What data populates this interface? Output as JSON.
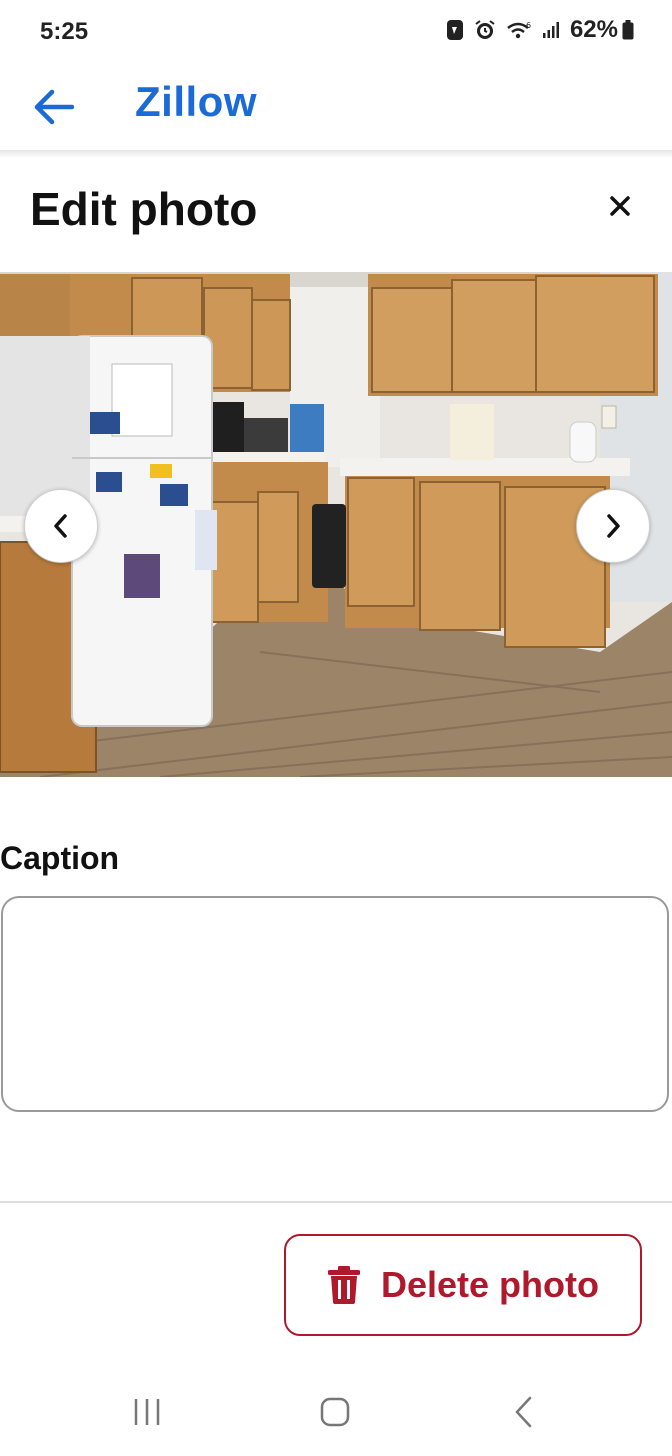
{
  "status_bar": {
    "time": "5:25",
    "battery": "62%",
    "icons": [
      "whatsapp-icon",
      "alarm-icon",
      "wifi-icon",
      "signal-icon",
      "battery-icon"
    ]
  },
  "app_bar": {
    "title": "Zillow",
    "back_icon": "arrow-left-icon",
    "accent_color": "#1a6bd8"
  },
  "modal": {
    "title": "Edit photo",
    "close_icon": "close-icon"
  },
  "photo": {
    "prev_icon": "chevron-left-icon",
    "next_icon": "chevron-right-icon"
  },
  "caption": {
    "label": "Caption",
    "value": "",
    "placeholder": ""
  },
  "actions": {
    "delete_label": "Delete photo",
    "delete_icon": "trash-icon",
    "delete_color": "#b0182c"
  },
  "system_nav": {
    "icons": [
      "recent-apps-icon",
      "home-icon",
      "system-back-icon"
    ]
  }
}
